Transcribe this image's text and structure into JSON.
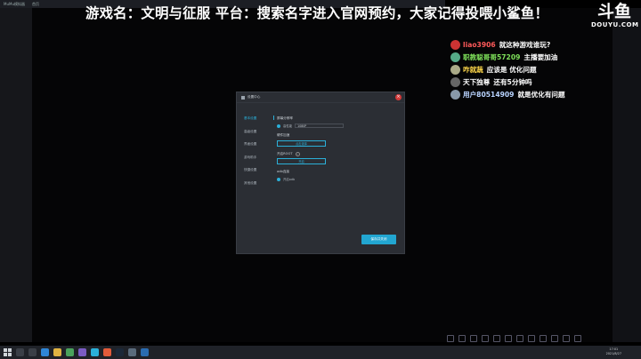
{
  "emulator": {
    "app_title": "MuMu模拟器",
    "tab": "首页"
  },
  "banner": {
    "text": "游戏名：文明与征服  平台：搜索名字进入官网预约，大家记得投喂小鲨鱼！"
  },
  "logo": {
    "cn": "斗鱼",
    "en": "DOUYU.COM"
  },
  "chat": [
    {
      "user": "liao3906",
      "message": "就这种游戏谁玩?",
      "user_color": "#ff5a5a",
      "avatar_color": "#c33"
    },
    {
      "user": "职教聪哥哥57209",
      "message": "主播要加油",
      "user_color": "#7ee05a",
      "avatar_color": "#5a8"
    },
    {
      "user": "咋就蔬",
      "message": "应该是 优化问题",
      "user_color": "#ffd84a",
      "avatar_color": "#aa8"
    },
    {
      "user": "天下独尊",
      "message": "还有5分钟吗",
      "user_color": "#ffffff",
      "avatar_color": "#666"
    },
    {
      "user": "用户80514909",
      "message": "就是优化有问题",
      "user_color": "#b9d4ff",
      "avatar_color": "#89a"
    }
  ],
  "dialog": {
    "title": "设置中心",
    "close_icon": "×",
    "nav": [
      "基本设置",
      "高级设置",
      "界面设置",
      "游戏助手",
      "快捷设置",
      "其他设置"
    ],
    "sections": {
      "resolution_label": "屏幕分辨率",
      "resolution_option": "高性能",
      "resolution_value": "1080P",
      "gpu_label": "硬件加速",
      "gpu_button": "点击选择",
      "root_label": "开启ROOT",
      "root_button": "开启",
      "other_label": "adb连接",
      "other_option": "开启adb"
    },
    "save_label": "保存并关闭"
  },
  "taskbar": {
    "time": "17:01",
    "date": "2021/8/27"
  }
}
